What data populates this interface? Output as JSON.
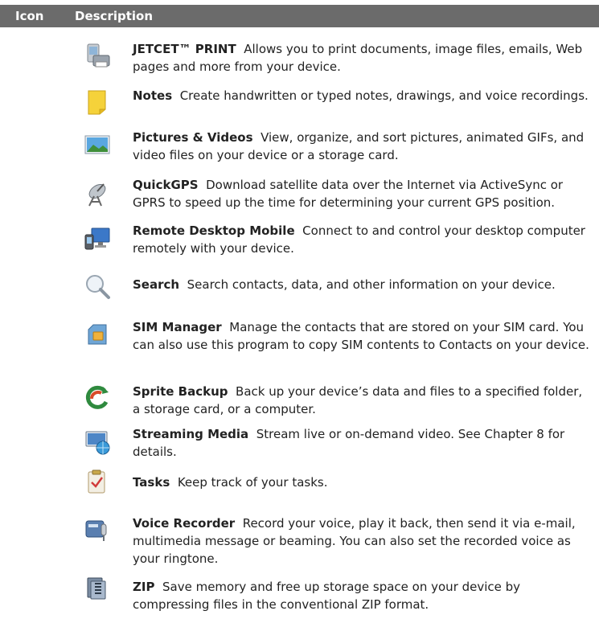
{
  "header": {
    "icon_col": "Icon",
    "desc_col": "Description"
  },
  "rows": [
    {
      "name": "JETCET™ PRINT",
      "text": "Allows you to print documents, image files, emails, Web pages and more from your device.",
      "icon": "printer-phone-icon"
    },
    {
      "name": "Notes",
      "text": "Create handwritten or typed notes, drawings, and voice recordings.",
      "icon": "notes-icon"
    },
    {
      "name": "Pictures & Videos",
      "text": "View, organize, and sort pictures, animated GIFs, and video files on your device or a storage card.",
      "icon": "pictures-icon"
    },
    {
      "name": "QuickGPS",
      "text": "Download satellite data over the Internet via ActiveSync or GPRS to speed up the time for determining your current GPS position.",
      "icon": "satellite-icon"
    },
    {
      "name": "Remote Desktop Mobile",
      "text": "Connect to and control your desktop computer remotely with your device.",
      "icon": "remote-desktop-icon"
    },
    {
      "name": "Search",
      "text": "Search contacts, data, and other information on your device.",
      "icon": "search-icon"
    },
    {
      "name": "SIM Manager",
      "text": "Manage the contacts that are stored on your SIM card. You can also use this program to copy SIM contents to Contacts on your device.",
      "icon": "sim-card-icon"
    },
    {
      "name": "Sprite Backup",
      "text": "Back up your device’s data and files to a specified folder, a storage card, or a computer.",
      "icon": "backup-icon"
    },
    {
      "name": "Streaming Media",
      "text": "Stream live or on-demand video. See Chapter 8 for details.",
      "icon": "streaming-media-icon"
    },
    {
      "name": "Tasks",
      "text": "Keep track of your tasks.",
      "icon": "tasks-icon"
    },
    {
      "name": "Voice Recorder",
      "text": "Record your voice, play it back, then send it via e-mail, multimedia message or beaming. You can also set the recorded voice as your ringtone.",
      "icon": "voice-recorder-icon"
    },
    {
      "name": "ZIP",
      "text": "Save memory and free up storage space on your device by compressing files in the conventional ZIP format.",
      "icon": "zip-icon"
    }
  ]
}
